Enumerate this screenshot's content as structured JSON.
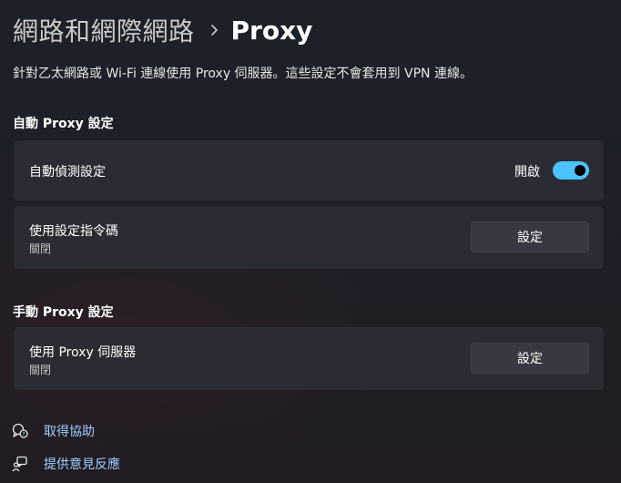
{
  "header": {
    "parent": "網路和網際網路",
    "separator_icon": "chevron-right-icon",
    "current": "Proxy"
  },
  "description": "針對乙太網路或 Wi-Fi 連線使用 Proxy 伺服器。這些設定不會套用到 VPN 連線。",
  "auto_section": {
    "title": "自動 Proxy 設定",
    "auto_detect": {
      "label": "自動偵測設定",
      "toggle_state_label": "開啟",
      "toggle_on": true
    },
    "setup_script": {
      "label": "使用設定指令碼",
      "status": "關閉",
      "button_label": "設定"
    }
  },
  "manual_section": {
    "title": "手動 Proxy 設定",
    "proxy_server": {
      "label": "使用 Proxy 伺服器",
      "status": "關閉",
      "button_label": "設定"
    }
  },
  "links": [
    {
      "label": "取得協助",
      "icon": "help-chat-icon"
    },
    {
      "label": "提供意見反應",
      "icon": "feedback-icon"
    }
  ],
  "colors": {
    "accent": "#4cc2ff",
    "link": "#9ccfff",
    "card": "#2b2c33"
  }
}
